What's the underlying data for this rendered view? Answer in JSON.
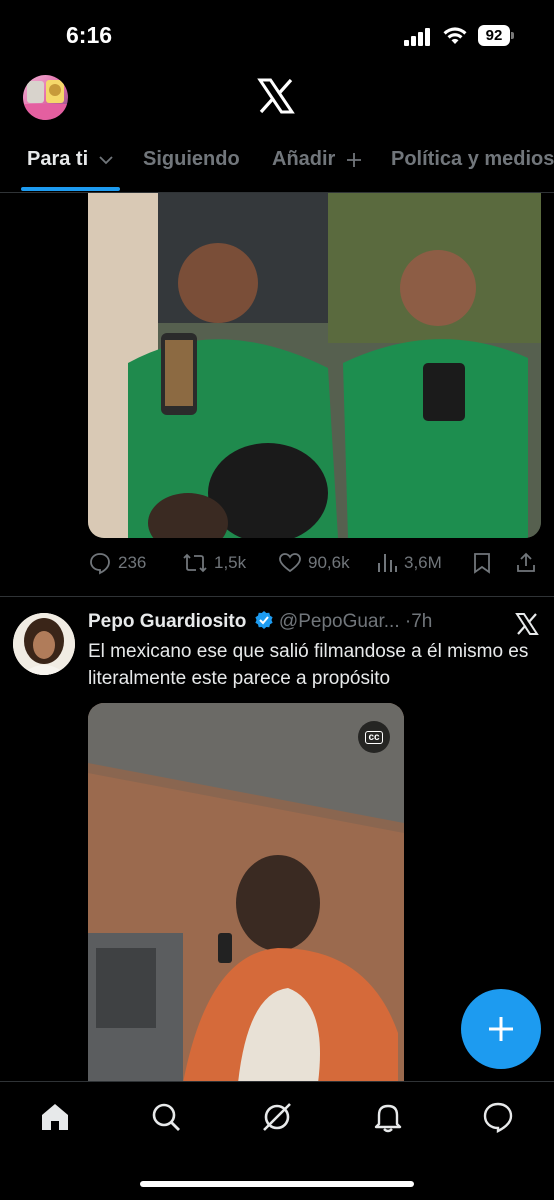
{
  "status_bar": {
    "time": "6:16",
    "battery": "92",
    "icons": [
      "cellular-signal-icon",
      "wifi-icon",
      "battery-icon"
    ]
  },
  "header": {
    "logo": "x-logo"
  },
  "tabs": [
    {
      "label": "Para ti",
      "active": true,
      "icon": "chevron-down-icon"
    },
    {
      "label": "Siguiendo",
      "active": false
    },
    {
      "label": "Añadir",
      "active": false,
      "icon": "plus-icon"
    },
    {
      "label": "Política y medios",
      "active": false
    }
  ],
  "tweet1": {
    "stats": {
      "replies": "236",
      "reposts": "1,5k",
      "likes": "90,6k",
      "views": "3,6M"
    }
  },
  "tweet2": {
    "name": "Pepo Guardiosito",
    "verified": true,
    "handle": "@PepoGuar...",
    "separator": "·",
    "time": "7h",
    "text": "El mexicano ese que salió filmandose a él mismo es literalmente este parece a propósito",
    "media_badge": "cc"
  },
  "colors": {
    "accent": "#1d9bf0",
    "muted": "#71767b",
    "text": "#e7e9ea",
    "background": "#000000"
  },
  "bottom_nav": [
    "home-icon",
    "search-icon",
    "grok-icon",
    "notifications-icon",
    "messages-icon"
  ]
}
